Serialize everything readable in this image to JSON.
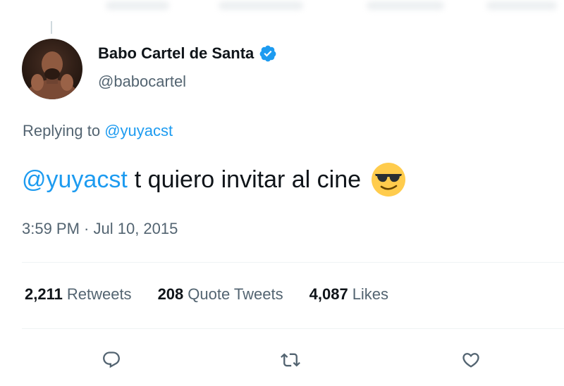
{
  "tweet": {
    "author_name": "Babo Cartel de Santa",
    "author_handle": "@babocartel",
    "replying_prefix": "Replying to",
    "replying_to": "@yuyacst",
    "text_mention": "@yuyacst",
    "text_body": "t quiero invitar al cine",
    "emoji": "smiling-face-with-sunglasses",
    "timestamp": "3:59 PM · Jul 10, 2015"
  },
  "stats": [
    {
      "value": "2,211",
      "label": "Retweets"
    },
    {
      "value": "208",
      "label": "Quote Tweets"
    },
    {
      "value": "4,087",
      "label": "Likes"
    }
  ],
  "actions": [
    "reply-icon",
    "retweet-icon",
    "like-icon"
  ],
  "colors": {
    "accent": "#1d9bf0",
    "secondary_text": "#536471",
    "primary_text": "#0f1419",
    "verified": "#1d9bf0"
  }
}
